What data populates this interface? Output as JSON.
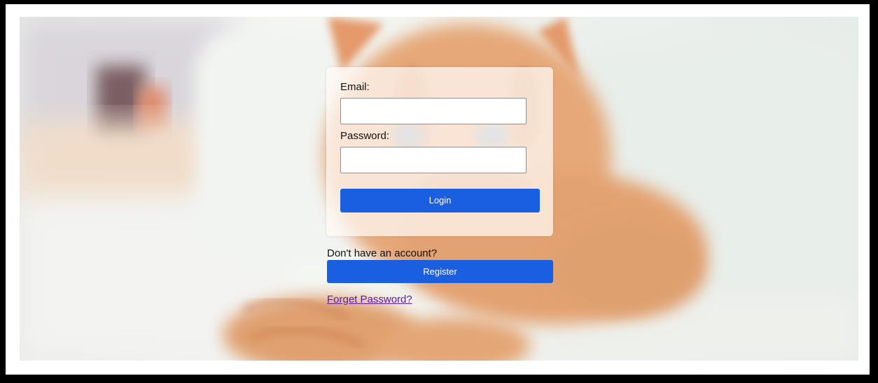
{
  "colors": {
    "button_blue": "#1a5fe0",
    "link_purple": "#5a1a9e",
    "frame_white": "#ffffff",
    "outer_background": "#000000"
  },
  "background": {
    "image": "blurred-orange-cat-photo"
  },
  "login_form": {
    "email_label": "Email:",
    "email_value": "",
    "password_label": "Password:",
    "password_value": "",
    "login_button": "Login"
  },
  "register": {
    "prompt": "Don't have an account?",
    "button": "Register"
  },
  "forgot_password": {
    "link": "Forget Password?"
  }
}
